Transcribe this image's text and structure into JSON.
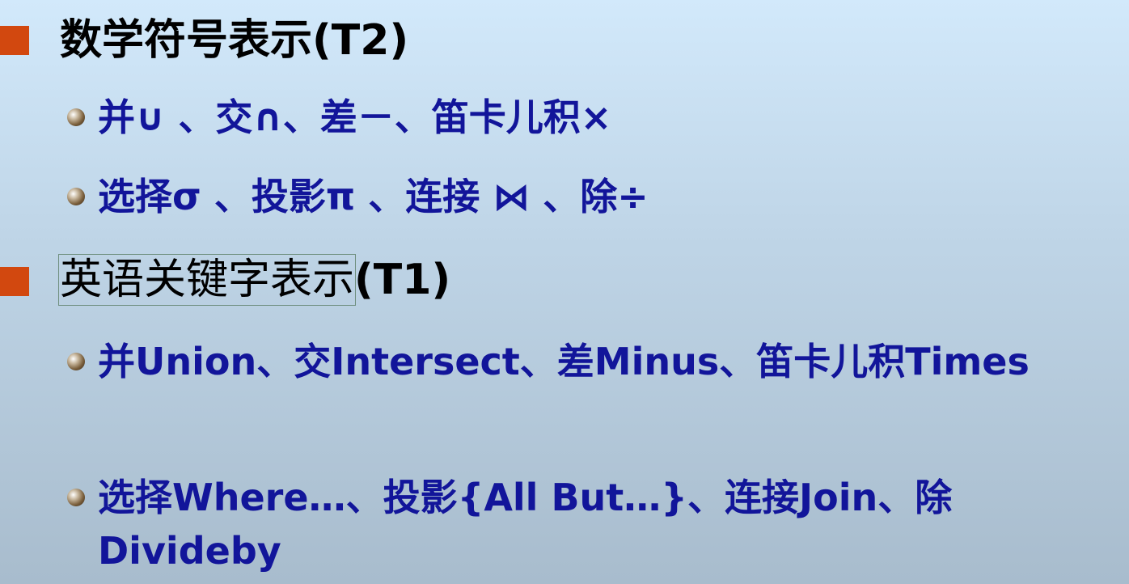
{
  "sections": [
    {
      "heading": "数学符号表示(T2)",
      "items": [
        "并∪ 、交∩、差－、笛卡儿积×",
        "选择σ 、投影π 、连接 ⋈ 、除÷"
      ]
    },
    {
      "heading_boxed": "英语关键字表示",
      "heading_rest": "(T1)",
      "items": [
        "并Union、交Intersect、差Minus、笛卡儿积Times",
        "选择Where…、投影{All But…}、连接Join、除Divideby"
      ]
    }
  ],
  "colors": {
    "heading_bullet": "#d2480f",
    "item_text": "#12159a",
    "heading_text": "#000000"
  }
}
